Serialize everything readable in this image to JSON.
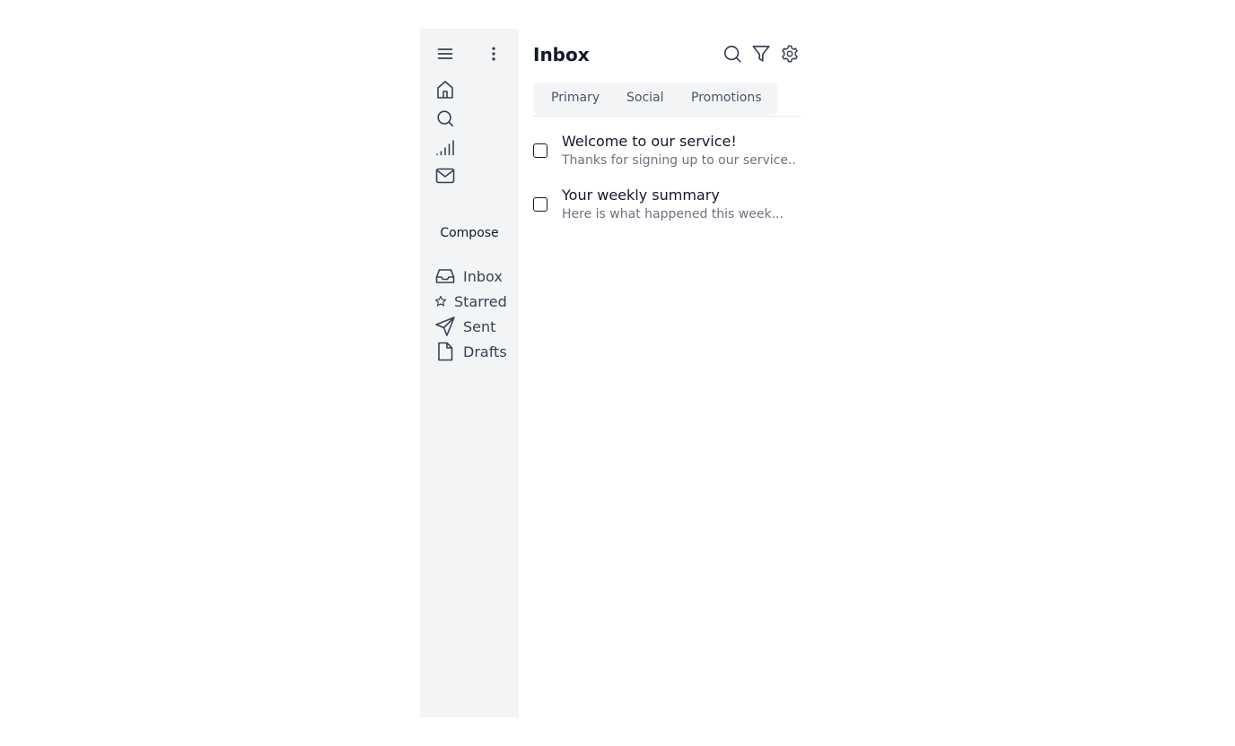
{
  "sidebar": {
    "top_icons": [
      "menu-icon",
      "more-vertical-icon"
    ],
    "nav_icons": [
      "home-icon",
      "search-icon",
      "signal-icon",
      "mail-icon"
    ],
    "compose_label": "Compose",
    "folders": [
      {
        "label": "Inbox",
        "icon": "inbox-icon"
      },
      {
        "label": "Starred",
        "icon": "star-icon"
      },
      {
        "label": "Sent",
        "icon": "send-icon"
      },
      {
        "label": "Drafts",
        "icon": "file-icon"
      }
    ]
  },
  "main": {
    "title": "Inbox",
    "header_icons": [
      "search-icon",
      "filter-icon",
      "settings-icon"
    ],
    "tabs": [
      {
        "label": "Primary"
      },
      {
        "label": "Social"
      },
      {
        "label": "Promotions"
      }
    ],
    "emails": [
      {
        "subject": "Welcome to our service!",
        "preview": "Thanks for signing up to our service..."
      },
      {
        "subject": "Your weekly summary",
        "preview": "Here is what happened this week..."
      }
    ]
  },
  "colors": {
    "sidebar_bg": "#f3f4f6",
    "text_primary": "#111827",
    "text_secondary": "#6b7280",
    "icon": "#374151"
  }
}
